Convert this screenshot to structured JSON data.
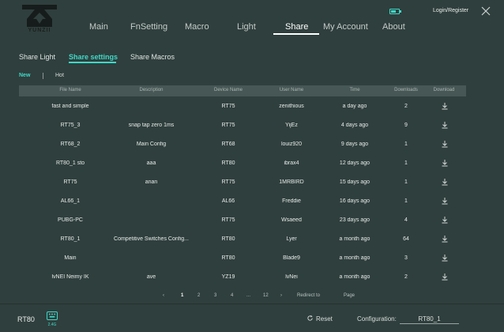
{
  "logo": {
    "text": "YUNZII"
  },
  "nav": {
    "items": [
      {
        "label": "Main"
      },
      {
        "label": "FnSetting"
      },
      {
        "label": "Macro"
      },
      {
        "label": "Light"
      },
      {
        "label": "Share"
      },
      {
        "label": "My Account"
      },
      {
        "label": "About"
      }
    ],
    "active": "Share"
  },
  "header": {
    "login_label": "Login/Register"
  },
  "subtabs": {
    "items": [
      {
        "label": "Share Light"
      },
      {
        "label": "Share settings"
      },
      {
        "label": "Share Macros"
      }
    ],
    "active": "Share settings"
  },
  "filters": {
    "new_label": "New",
    "hot_label": "Hot",
    "active": "New"
  },
  "table": {
    "headers": [
      "File Name",
      "Description",
      "Device Name",
      "User Name",
      "Time",
      "Downloads",
      "Download"
    ],
    "rows": [
      {
        "file": "fast and simple",
        "desc": "",
        "device": "RT75",
        "user": "zenithious",
        "time": "a day ago",
        "downloads": "2"
      },
      {
        "file": "RT75_3",
        "desc": "snap tap zero 1ms",
        "device": "RT75",
        "user": "YijEz",
        "time": "4 days ago",
        "downloads": "9"
      },
      {
        "file": "RT68_2",
        "desc": "Main Config",
        "device": "RT68",
        "user": "louiz920",
        "time": "9 days ago",
        "downloads": "1"
      },
      {
        "file": "RT80_1 sto",
        "desc": "aaa",
        "device": "RT80",
        "user": "ibrax4",
        "time": "12 days ago",
        "downloads": "1"
      },
      {
        "file": "RT75",
        "desc": "anan",
        "device": "RT75",
        "user": "1MRBIRD",
        "time": "15 days ago",
        "downloads": "1"
      },
      {
        "file": "AL66_1",
        "desc": "",
        "device": "AL66",
        "user": "Freddie",
        "time": "16 days ago",
        "downloads": "1"
      },
      {
        "file": "PUBG-PC",
        "desc": "",
        "device": "RT75",
        "user": "Wsaeed",
        "time": "23 days ago",
        "downloads": "4"
      },
      {
        "file": "RT80_1",
        "desc": "Competitive Switches Config...",
        "device": "RT80",
        "user": "Lyer",
        "time": "a month ago",
        "downloads": "64"
      },
      {
        "file": "Main",
        "desc": "",
        "device": "RT80",
        "user": "Blade9",
        "time": "a month ago",
        "downloads": "3"
      },
      {
        "file": "lvNEI Neimy IK",
        "desc": "ave",
        "device": "YZ19",
        "user": "lvNei",
        "time": "a month ago",
        "downloads": "2"
      }
    ]
  },
  "pagination": {
    "prev": "‹",
    "pages": [
      "1",
      "2",
      "3",
      "4",
      "...",
      "12"
    ],
    "current": "1",
    "next": "›",
    "redirect_label": "Redirect to",
    "page_label": "Page"
  },
  "footer": {
    "model": "RT80",
    "connection_label": "2.4G",
    "reset_label": "Reset",
    "config_label": "Configuration:",
    "config_value": "RT80_1"
  },
  "colors": {
    "background": "#2f3f3d",
    "accent": "#3fd8c8",
    "table_header": "#475755"
  }
}
